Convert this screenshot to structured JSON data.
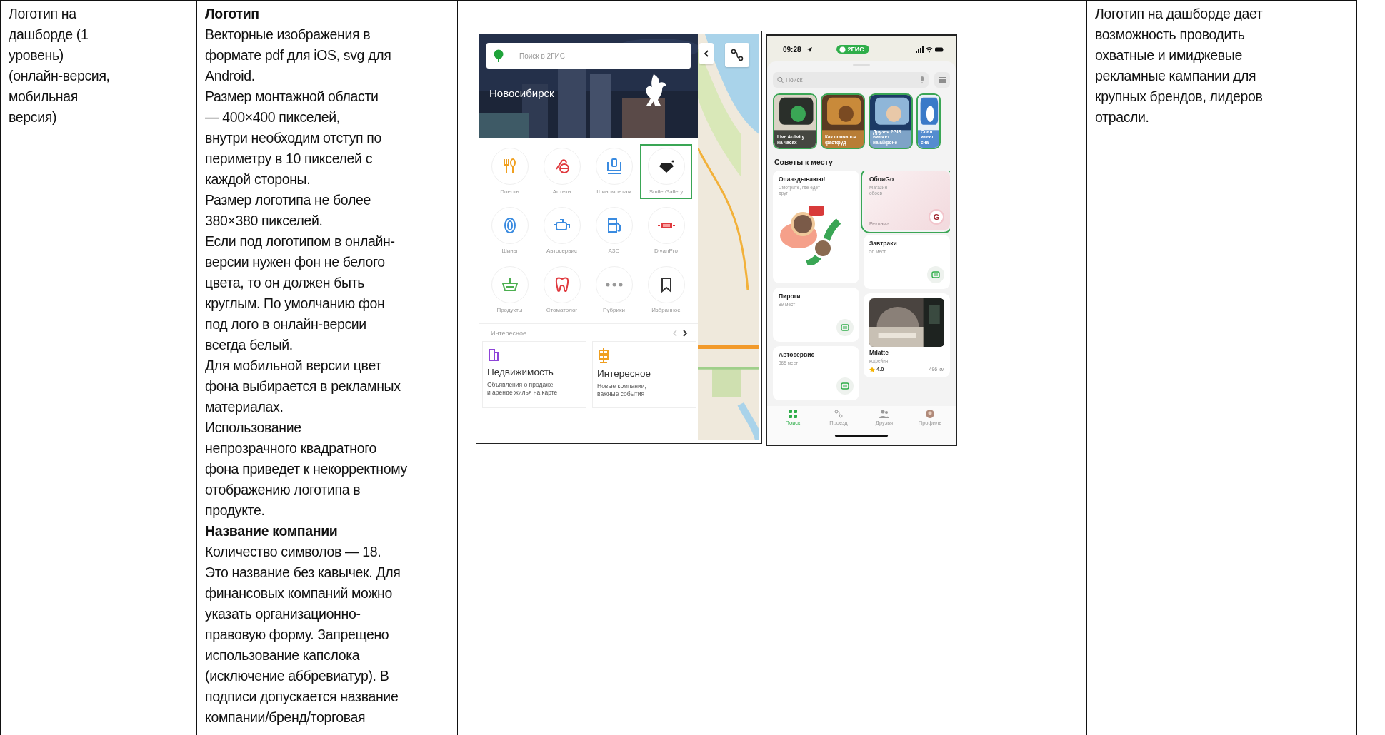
{
  "table": {
    "rows": [
      {
        "cell_1": {
          "lines": [
            "Логотип на",
            "дашборде (1",
            "уровень)",
            "(онлайн-версия,",
            "мобильная",
            "версия)"
          ]
        },
        "cell_2": {
          "blocks": [
            {
              "kind": "heading",
              "lines": [
                "Логотип"
              ]
            },
            {
              "kind": "text",
              "lines": [
                "Векторные изображения в",
                "формате pdf для iOS, svg для",
                "Android."
              ]
            },
            {
              "kind": "text",
              "lines": [
                "Размер монтажной области",
                "— 400×400 пикселей,",
                "внутри необходим отступ по",
                "периметру в 10 пикселей с",
                "каждой стороны."
              ]
            },
            {
              "kind": "text",
              "lines": [
                "Размер логотипа не более",
                "380×380 пикселей."
              ]
            },
            {
              "kind": "text",
              "lines": [
                "Если под логотипом в онлайн-",
                "версии нужен фон не белого",
                "цвета, то он должен быть",
                "круглым. По умолчанию фон",
                "под лого в онлайн-версии",
                "всегда белый."
              ]
            },
            {
              "kind": "text",
              "lines": [
                "Для мобильной версии цвет",
                "фона выбирается в рекламных",
                "материалах."
              ]
            },
            {
              "kind": "text",
              "lines": [
                "Использование",
                "непрозрачного квадратного",
                "фона приведет к некорректному",
                "отображению логотипа в",
                "продукте."
              ]
            },
            {
              "kind": "heading",
              "lines": [
                "Название компании"
              ]
            },
            {
              "kind": "text",
              "lines": [
                "Количество символов — 18.",
                "Это название без кавычек. Для",
                "финансовых компаний можно",
                "указать организационно-",
                "правовую форму. Запрещено",
                "использование капслока",
                "(исключение аббревиатур).  В",
                "подписи допускается название",
                "компании/бренд/торговая"
              ]
            }
          ]
        },
        "cell_3": {
          "web_screenshot": {
            "search": {
              "placeholder": "Поиск в 2ГИС"
            },
            "city": "Новосибирск",
            "categories": [
              {
                "label": "Поесть",
                "highlighted": false
              },
              {
                "label": "Аптеки",
                "highlighted": false
              },
              {
                "label": "Шиномонтаж",
                "highlighted": false
              },
              {
                "label": "Smile Gallery",
                "highlighted": true
              },
              {
                "label": "Шины",
                "highlighted": false
              },
              {
                "label": "Автосервис",
                "highlighted": false
              },
              {
                "label": "АЗС",
                "highlighted": false
              },
              {
                "label": "DivanPro",
                "highlighted": false
              },
              {
                "label": "Продукты",
                "highlighted": false
              },
              {
                "label": "Стоматолог",
                "highlighted": false
              },
              {
                "label": "Рубрики",
                "highlighted": false
              },
              {
                "label": "Избранное",
                "highlighted": false
              }
            ],
            "section_title": "Интересное",
            "cards": [
              {
                "title": "Недвижимость",
                "lines": [
                  "Объявления о продаже",
                  "и аренде жилья на карте"
                ]
              },
              {
                "title": "Интересное",
                "lines": [
                  "Новые компании,",
                  "важные события"
                ]
              }
            ]
          },
          "mobile_screenshot": {
            "time": "09:28",
            "app_badge": "2ГИС",
            "search": {
              "placeholder": "Поиск"
            },
            "stories": [
              {
                "lines": [
                  "Live Activity",
                  "на часах"
                ]
              },
              {
                "lines": [
                  "Как появился",
                  "фастфуд"
                ]
              },
              {
                "lines": [
                  "Друзья 2GIS:",
                  "виджет",
                  "на айфоне"
                ]
              },
              {
                "lines": [
                  "Спал",
                  "идеал",
                  "сна"
                ]
              }
            ],
            "section_title": "Советы к месту",
            "tip_columns": [
              [
                {
                  "kind": "friend",
                  "title": "Опааздываюю!",
                  "lines": [
                    "Смотрите, где едет",
                    "друг"
                  ],
                  "highlighted": false
                },
                {
                  "kind": "category",
                  "title": "Пироги",
                  "lines": [
                    "89 мест"
                  ],
                  "highlighted": false
                },
                {
                  "kind": "category",
                  "title": "Автосервис",
                  "lines": [
                    "365 мест"
                  ],
                  "highlighted": false
                }
              ],
              [
                {
                  "kind": "ad",
                  "title": "ОбоиGo",
                  "lines": [
                    "Магазин",
                    "обоев"
                  ],
                  "ad_label": "Реклама",
                  "logo_letter": "G",
                  "highlighted": true
                },
                {
                  "kind": "category",
                  "title": "Завтраки",
                  "lines": [
                    "56 мест"
                  ],
                  "highlighted": false
                },
                {
                  "kind": "place",
                  "title": "Milatte",
                  "lines": [
                    "кофейня"
                  ],
                  "rating": "4.0",
                  "distance": "496 км",
                  "highlighted": false
                }
              ]
            ],
            "tabs": [
              {
                "label": "Поиск",
                "selected": true
              },
              {
                "label": "Проезд",
                "selected": false
              },
              {
                "label": "Друзья",
                "selected": false
              },
              {
                "label": "Профиль",
                "selected": false
              }
            ]
          }
        },
        "cell_4": {
          "lines": [
            "Логотип на дашборде дает",
            "возможность проводить",
            "охватные и имиджевые",
            "рекламные кампании для",
            "крупных брендов, лидеров",
            "отрасли."
          ]
        }
      }
    ]
  }
}
